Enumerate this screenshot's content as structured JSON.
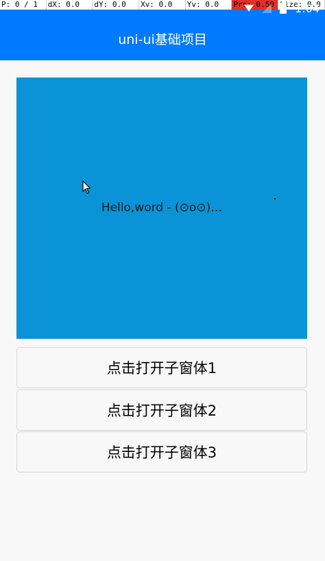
{
  "debug_overlay": {
    "pointer": "P: 0 / 1",
    "dx": "dX: 0.0",
    "dy": "dY: 0.0",
    "xv": "Xv: 0.0",
    "yv": "Yv: 0.0",
    "prs": "Prs: 0.50",
    "size": "Size: 0.0"
  },
  "status_bar": {
    "time": "1:04"
  },
  "nav": {
    "title": "uni-ui基础项目"
  },
  "hero": {
    "text": "Hello,word - (⊙o⊙)…"
  },
  "buttons": [
    {
      "label": "点击打开子窗体1"
    },
    {
      "label": "点击打开子窗体2"
    },
    {
      "label": "点击打开子窗体3"
    }
  ],
  "colors": {
    "header": "#007aff",
    "hero_background": "#0a93d6",
    "page_background": "#f8f8f8",
    "pressure_indicator": "#e0302a"
  }
}
